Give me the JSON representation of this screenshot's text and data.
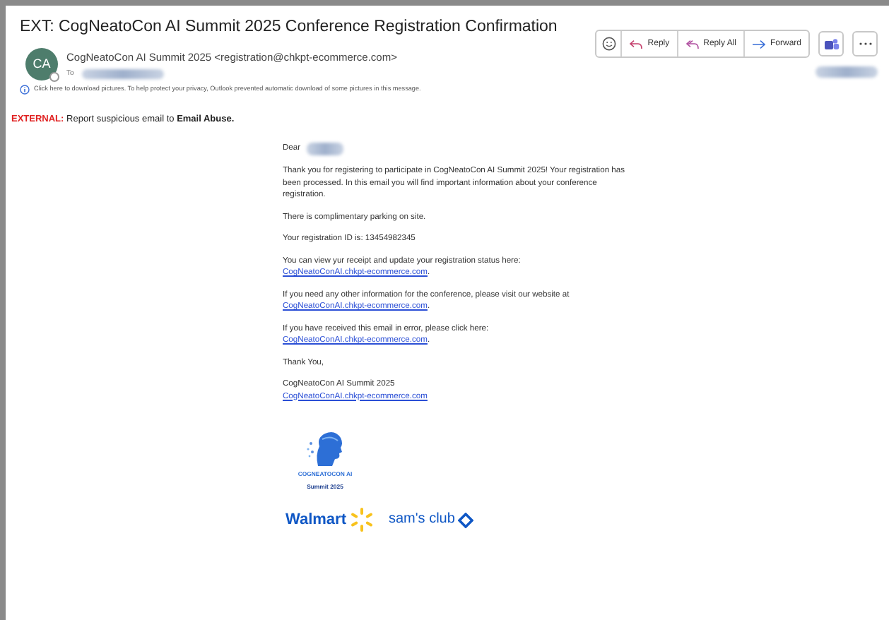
{
  "subject": "EXT: CogNeatoCon AI Summit 2025 Conference Registration Confirmation",
  "sender": {
    "initials": "CA",
    "name": "CogNeatoCon AI Summit 2025 <registration@chkpt-ecommerce.com>",
    "to_label": "To"
  },
  "actions": [
    {
      "kind": "emoji"
    },
    {
      "kind": "reply",
      "label": "Reply"
    },
    {
      "kind": "reply_all",
      "label": "Reply All"
    },
    {
      "kind": "forward",
      "label": "Forward"
    },
    {
      "kind": "teams"
    },
    {
      "kind": "more"
    }
  ],
  "info_bar": "Click here to download pictures. To help protect your privacy, Outlook prevented automatic download of some pictures in this message.",
  "external_banner": {
    "tag": "EXTERNAL:",
    "text": "Report suspicious email to",
    "link": "Email Abuse."
  },
  "body": [
    {
      "kind": "greeting",
      "text": "Dear"
    },
    {
      "kind": "paragraph",
      "text": "Thank you for registering to participate in CogNeatoCon AI Summit 2025! Your registration has been processed. In this email you will find important information about your conference registration."
    },
    {
      "kind": "paragraph",
      "text": "There is complimentary parking on site."
    },
    {
      "kind": "paragraph",
      "text": "Your registration ID is: 13454982345"
    },
    {
      "kind": "link_below",
      "text": "You can view yur receipt and update your registration status here:",
      "link": "CogNeatoConAI.chkpt-ecommerce.com",
      "after": "."
    },
    {
      "kind": "link_inline",
      "text": "If you need any other information for the conference, please visit our website at",
      "link": "CogNeatoConAI.chkpt-ecommerce.com",
      "after": "."
    },
    {
      "kind": "link_below",
      "text": "If you have received this email in error, please click here:",
      "link": "CogNeatoConAI.chkpt-ecommerce.com",
      "after": "."
    },
    {
      "kind": "paragraph",
      "text": "Thank You,"
    },
    {
      "kind": "link_below",
      "text": "CogNeatoCon AI Summit 2025",
      "link": "CogNeatoConAI.chkpt-ecommerce.com"
    }
  ],
  "logos": {
    "event_name": "COGNEATOCON AI",
    "event_year": "Summit 2025",
    "sponsor_1": "Walmart",
    "sponsor_2": "sam's club"
  }
}
